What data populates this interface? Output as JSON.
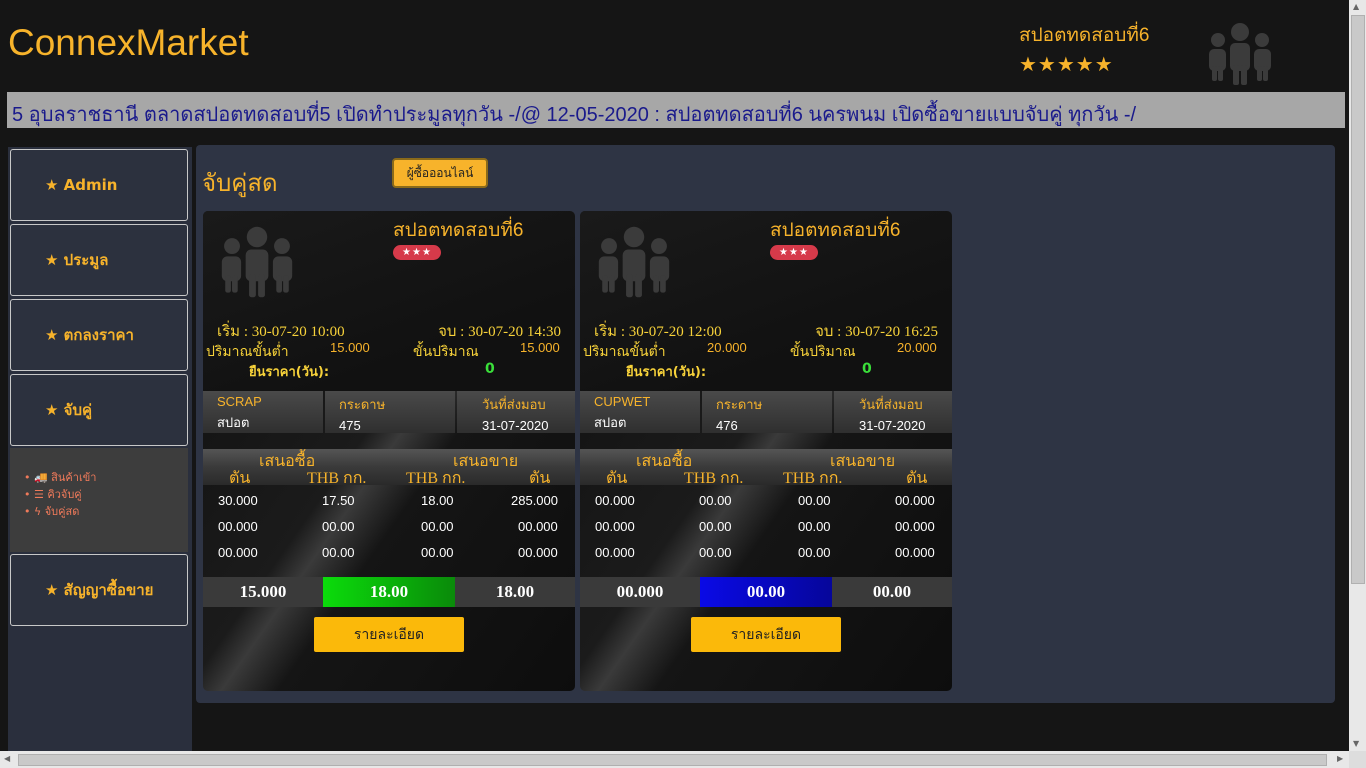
{
  "header": {
    "brand": "ConnexMarket",
    "user_name": "สปอตทดสอบที่6",
    "user_stars": "★★★★★",
    "user_icon": "people-icon"
  },
  "ticker": {
    "text": "5 อุบลราชธานี ตลาดสปอตทดสอบที่5 เปิดทำประมูลทุกวัน -/@ 12-05-2020 : สปอตทดสอบที่6 นครพนม เปิดซื้อขายแบบจับคู่ ทุกวัน -/"
  },
  "sidebar": {
    "items": [
      {
        "label": "★ Admin"
      },
      {
        "label": "★ ประมูล"
      },
      {
        "label": "★ ตกลงราคา"
      },
      {
        "label": "★ จับคู่"
      },
      {
        "label": "★ สัญญาซื้อขาย"
      }
    ],
    "sub_items": [
      {
        "label": "• 🚚 สินค้าเข้า",
        "icon": "truck-icon"
      },
      {
        "label": "• ☰ คิวจับคู่",
        "icon": "list-icon"
      },
      {
        "label": "• ϟ จับคู่สด",
        "icon": "bolt-icon"
      }
    ]
  },
  "main": {
    "title": "จับคู่สด",
    "online_button": "ผู้ซื้อออนไลน์",
    "cards": [
      {
        "name": "สปอตทดสอบที่6",
        "badge": "★★★",
        "start": "เริ่ม : 30-07-20 10:00",
        "end": "จบ : 30-07-20 14:30",
        "min_qty_label": "ปริมาณขั้นต่ำ",
        "min_qty": "15.000",
        "step_label": "ขั้นปริมาณ",
        "step": "15.000",
        "hold_label": "ยืนราคา(วัน):",
        "hold": "0",
        "product_code": "SCRAP",
        "product_type": "สปอต",
        "category_label": "กระดาษ",
        "category_value": "475",
        "delivery_label": "วันที่ส่งมอบ",
        "delivery_value": "31-07-2020",
        "bid_label": "เสนอซื้อ",
        "ask_label": "เสนอขาย",
        "col_ton": "ตัน",
        "col_price": "THB กก.",
        "rows": [
          [
            "30.000",
            "17.50",
            "18.00",
            "285.000"
          ],
          [
            "00.000",
            "00.00",
            "00.00",
            "00.000"
          ],
          [
            "00.000",
            "00.00",
            "00.00",
            "00.000"
          ]
        ],
        "sum_qty": "15.000",
        "sum_match": "18.00",
        "sum_price": "18.00",
        "match_color": "#0bdc0b",
        "detail_button": "รายละเอียด"
      },
      {
        "name": "สปอตทดสอบที่6",
        "badge": "★★★",
        "start": "เริ่ม : 30-07-20 12:00",
        "end": "จบ : 30-07-20 16:25",
        "min_qty_label": "ปริมาณขั้นต่ำ",
        "min_qty": "20.000",
        "step_label": "ขั้นปริมาณ",
        "step": "20.000",
        "hold_label": "ยืนราคา(วัน):",
        "hold": "0",
        "product_code": "CUPWET",
        "product_type": "สปอต",
        "category_label": "กระดาษ",
        "category_value": "476",
        "delivery_label": "วันที่ส่งมอบ",
        "delivery_value": "31-07-2020",
        "bid_label": "เสนอซื้อ",
        "ask_label": "เสนอขาย",
        "col_ton": "ตัน",
        "col_price": "THB กก.",
        "rows": [
          [
            "00.000",
            "00.00",
            "00.00",
            "00.000"
          ],
          [
            "00.000",
            "00.00",
            "00.00",
            "00.000"
          ],
          [
            "00.000",
            "00.00",
            "00.00",
            "00.000"
          ]
        ],
        "sum_qty": "00.000",
        "sum_match": "00.00",
        "sum_price": "00.00",
        "match_color": "#0a0ae6",
        "detail_button": "รายละเอียด"
      }
    ]
  }
}
